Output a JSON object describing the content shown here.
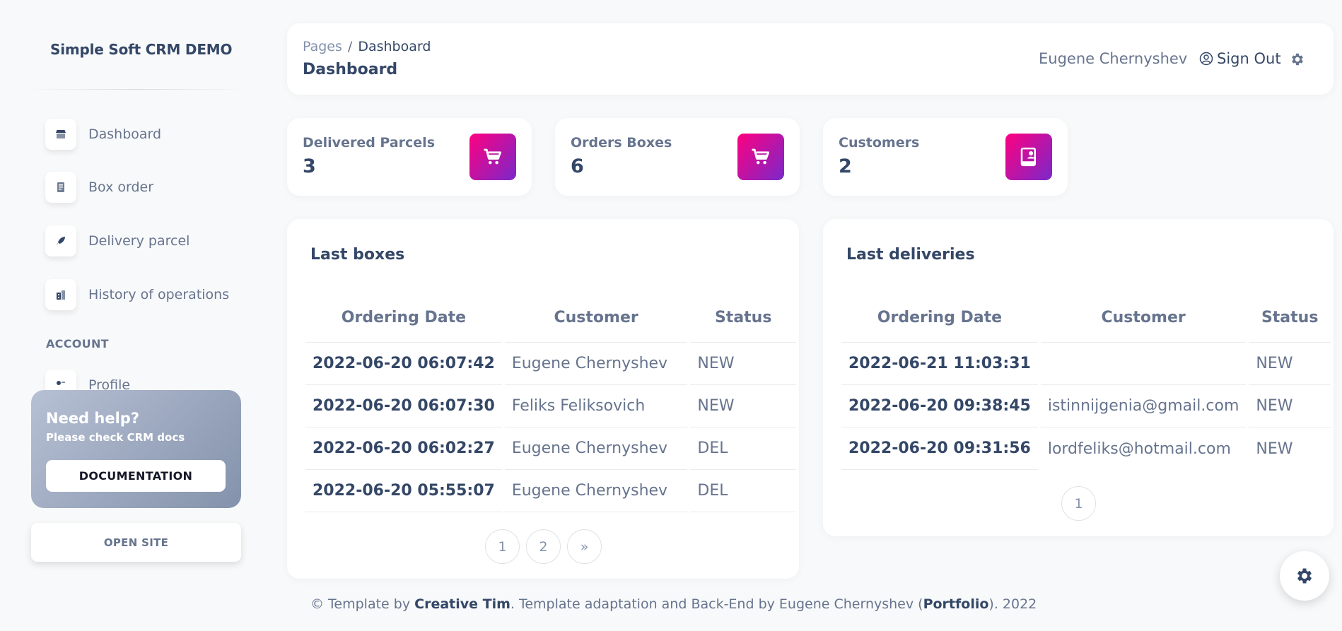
{
  "brand": "Simple Soft CRM DEMO",
  "sidebar": {
    "items": [
      {
        "label": "Dashboard",
        "icon": "shop-icon"
      },
      {
        "label": "Box order",
        "icon": "document-icon"
      },
      {
        "label": "Delivery parcel",
        "icon": "rocket-icon"
      },
      {
        "label": "History of operations",
        "icon": "office-icon"
      }
    ],
    "section_account": "ACCOUNT",
    "profile_label": "Profile",
    "help": {
      "title": "Need help?",
      "subtitle": "Please check CRM docs",
      "button": "DOCUMENTATION"
    },
    "open_site": "OPEN SITE"
  },
  "navbar": {
    "breadcrumb_root": "Pages",
    "breadcrumb_sep": "/",
    "breadcrumb_current": "Dashboard",
    "title": "Dashboard",
    "user": "Eugene Chernyshev",
    "sign_out": "Sign Out"
  },
  "stats": [
    {
      "label": "Delivered Parcels",
      "value": "3",
      "icon": "cart-icon"
    },
    {
      "label": "Orders Boxes",
      "value": "6",
      "icon": "cart-icon"
    },
    {
      "label": "Customers",
      "value": "2",
      "icon": "contact-book-icon"
    }
  ],
  "last_boxes": {
    "title": "Last boxes",
    "headers": [
      "Ordering Date",
      "Customer",
      "Status"
    ],
    "rows": [
      [
        "2022-06-20 06:07:42",
        "Eugene Chernyshev",
        "NEW"
      ],
      [
        "2022-06-20 06:07:30",
        "Feliks Feliksovich",
        "NEW"
      ],
      [
        "2022-06-20 06:02:27",
        "Eugene Chernyshev",
        "DEL"
      ],
      [
        "2022-06-20 05:55:07",
        "Eugene Chernyshev",
        "DEL"
      ]
    ],
    "pages": [
      "1",
      "2",
      "»"
    ]
  },
  "last_deliveries": {
    "title": "Last deliveries",
    "headers": [
      "Ordering Date",
      "Customer",
      "Status"
    ],
    "rows": [
      [
        "2022-06-21 11:03:31",
        "",
        "NEW"
      ],
      [
        "2022-06-20 09:38:45",
        "istinnijgenia@gmail.com",
        "NEW"
      ],
      [
        "2022-06-20 09:31:56",
        "lordfeliks@hotmail.com",
        "NEW"
      ]
    ],
    "pages": [
      "1"
    ]
  },
  "footer": {
    "prefix": "© Template by ",
    "link1": "Creative Tim",
    "middle": ". Template adaptation and Back-End by Eugene Chernyshev (",
    "link2": "Portfolio",
    "suffix": "). 2022"
  },
  "colors": {
    "accent_gradient_start": "#7928ca",
    "accent_gradient_end": "#ff0080",
    "text_dark": "#344767",
    "text_muted": "#67748e"
  }
}
